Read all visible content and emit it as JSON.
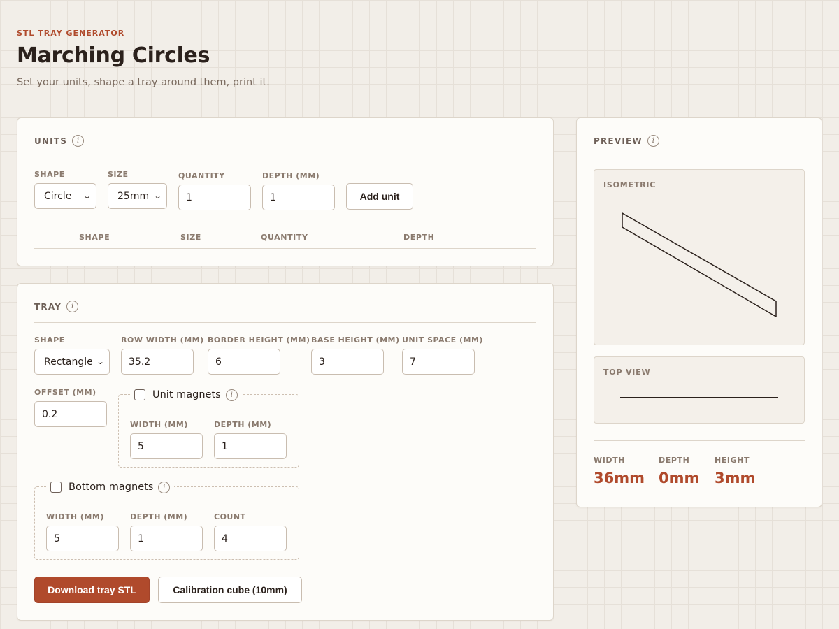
{
  "header": {
    "eyebrow": "STL TRAY GENERATOR",
    "title": "Marching Circles",
    "subtitle": "Set your units, shape a tray around them, print it."
  },
  "units": {
    "title": "UNITS",
    "shape_label": "SHAPE",
    "shape_value": "Circle",
    "size_label": "SIZE",
    "size_value": "25mm",
    "quantity_label": "QUANTITY",
    "quantity_value": "1",
    "depth_label": "DEPTH (MM)",
    "depth_value": "1",
    "add_button": "Add unit",
    "table_headers": [
      "SHAPE",
      "SIZE",
      "QUANTITY",
      "DEPTH"
    ],
    "rows": []
  },
  "tray": {
    "title": "TRAY",
    "shape_label": "SHAPE",
    "shape_value": "Rectangle",
    "row_width_label": "ROW WIDTH (MM)",
    "row_width_value": "35.2",
    "border_height_label": "BORDER HEIGHT (MM)",
    "border_height_value": "6",
    "base_height_label": "BASE HEIGHT (MM)",
    "base_height_value": "3",
    "unit_space_label": "UNIT SPACE (MM)",
    "unit_space_value": "7",
    "offset_label": "OFFSET (MM)",
    "offset_value": "0.2",
    "unit_magnets": {
      "label": "Unit magnets",
      "checked": false,
      "width_label": "WIDTH (MM)",
      "width_value": "5",
      "depth_label": "DEPTH (MM)",
      "depth_value": "1"
    },
    "bottom_magnets": {
      "label": "Bottom magnets",
      "checked": false,
      "width_label": "WIDTH (MM)",
      "width_value": "5",
      "depth_label": "DEPTH (MM)",
      "depth_value": "1",
      "count_label": "COUNT",
      "count_value": "4"
    },
    "download_button": "Download tray STL",
    "calibration_button": "Calibration cube (10mm)"
  },
  "preview": {
    "title": "PREVIEW",
    "isometric_label": "ISOMETRIC",
    "top_view_label": "TOP VIEW",
    "dimensions": [
      {
        "label": "WIDTH",
        "value": "36mm"
      },
      {
        "label": "DEPTH",
        "value": "0mm"
      },
      {
        "label": "HEIGHT",
        "value": "3mm"
      }
    ]
  },
  "colors": {
    "accent": "#b04a2c",
    "background": "#f2eee8",
    "card": "#fdfcf9"
  }
}
